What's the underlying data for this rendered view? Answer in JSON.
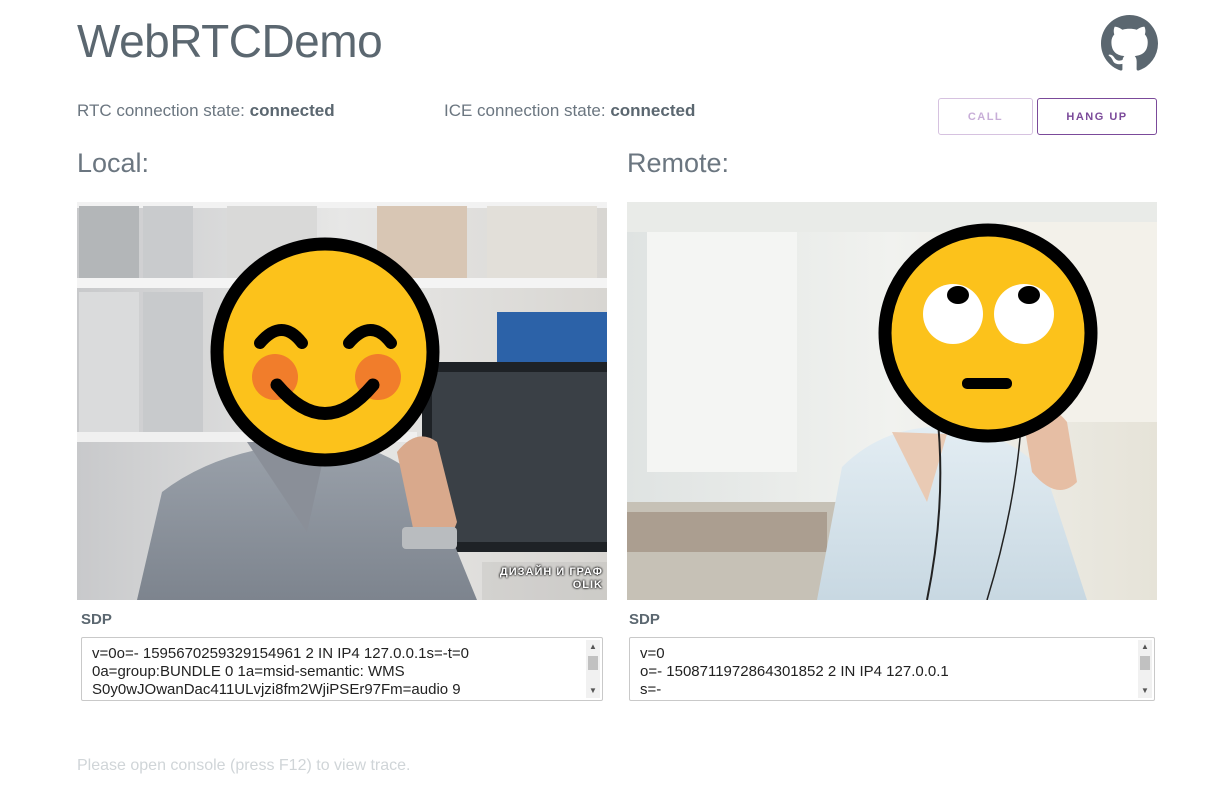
{
  "app": {
    "title": "WebRTCDemo"
  },
  "status": {
    "rtc_label": "RTC connection state:",
    "rtc_value": "connected",
    "ice_label": "ICE connection state:",
    "ice_value": "connected"
  },
  "buttons": {
    "call": "CALL",
    "hang_up": "HANG UP"
  },
  "local": {
    "label": "Local:",
    "sdp_label": "SDP",
    "sdp_text": "v=0o=- 1595670259329154961 2 IN IP4 127.0.0.1s=-t=0\n0a=group:BUNDLE 0 1a=msid-semantic: WMS\nS0y0wJOwanDac411ULvjzi8fm2WjiPSEr97Fm=audio 9",
    "watermark_line1": "ДИЗАЙН И ГРАФ",
    "watermark_line2": "OLIK"
  },
  "remote": {
    "label": "Remote:",
    "sdp_label": "SDP",
    "sdp_text": "v=0\no=- 1508711972864301852 2 IN IP4 127.0.0.1\ns=-"
  },
  "footer": {
    "text": "Please open console (press F12) to view trace."
  },
  "colors": {
    "accent": "#7b4a9a",
    "emoji_yellow": "#fcc21b",
    "emoji_outline": "#000000",
    "cheek": "#ed6c30"
  }
}
